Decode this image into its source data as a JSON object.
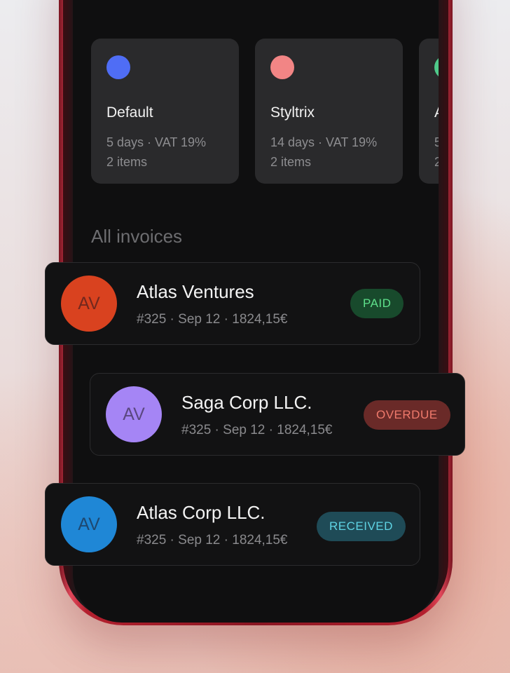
{
  "templates": [
    {
      "name": "Default",
      "meta_line1": "5 days · VAT 19%",
      "meta_line2": "2 items",
      "color": "#4f6df5"
    },
    {
      "name": "Styltrix",
      "meta_line1": "14 days · VAT 19%",
      "meta_line2": "2 items",
      "color": "#f28585"
    },
    {
      "name": "A",
      "meta_line1": "5",
      "meta_line2": "2",
      "color": "#4fc98a"
    }
  ],
  "section_title": "All invoices",
  "invoices": [
    {
      "initials": "AV",
      "client": "Atlas Ventures",
      "detail": "#325 · Sep 12 · 1824,15€",
      "status": "PAID",
      "avatar_color": "#d9421f",
      "badge_bg": "#184a2c",
      "badge_fg": "#5ee08b"
    },
    {
      "initials": "AV",
      "client": "Saga Corp LLC.",
      "detail": "#325 · Sep 12 · 1824,15€",
      "status": "OVERDUE",
      "avatar_color": "#a585f5",
      "badge_bg": "#6a2a28",
      "badge_fg": "#f07a6c"
    },
    {
      "initials": "AV",
      "client": "Atlas Corp LLC.",
      "detail": "#325 · Sep 12 · 1824,15€",
      "status": "RECEIVED",
      "avatar_color": "#1f87d6",
      "badge_bg": "#1f4b57",
      "badge_fg": "#5fd4e4"
    }
  ]
}
